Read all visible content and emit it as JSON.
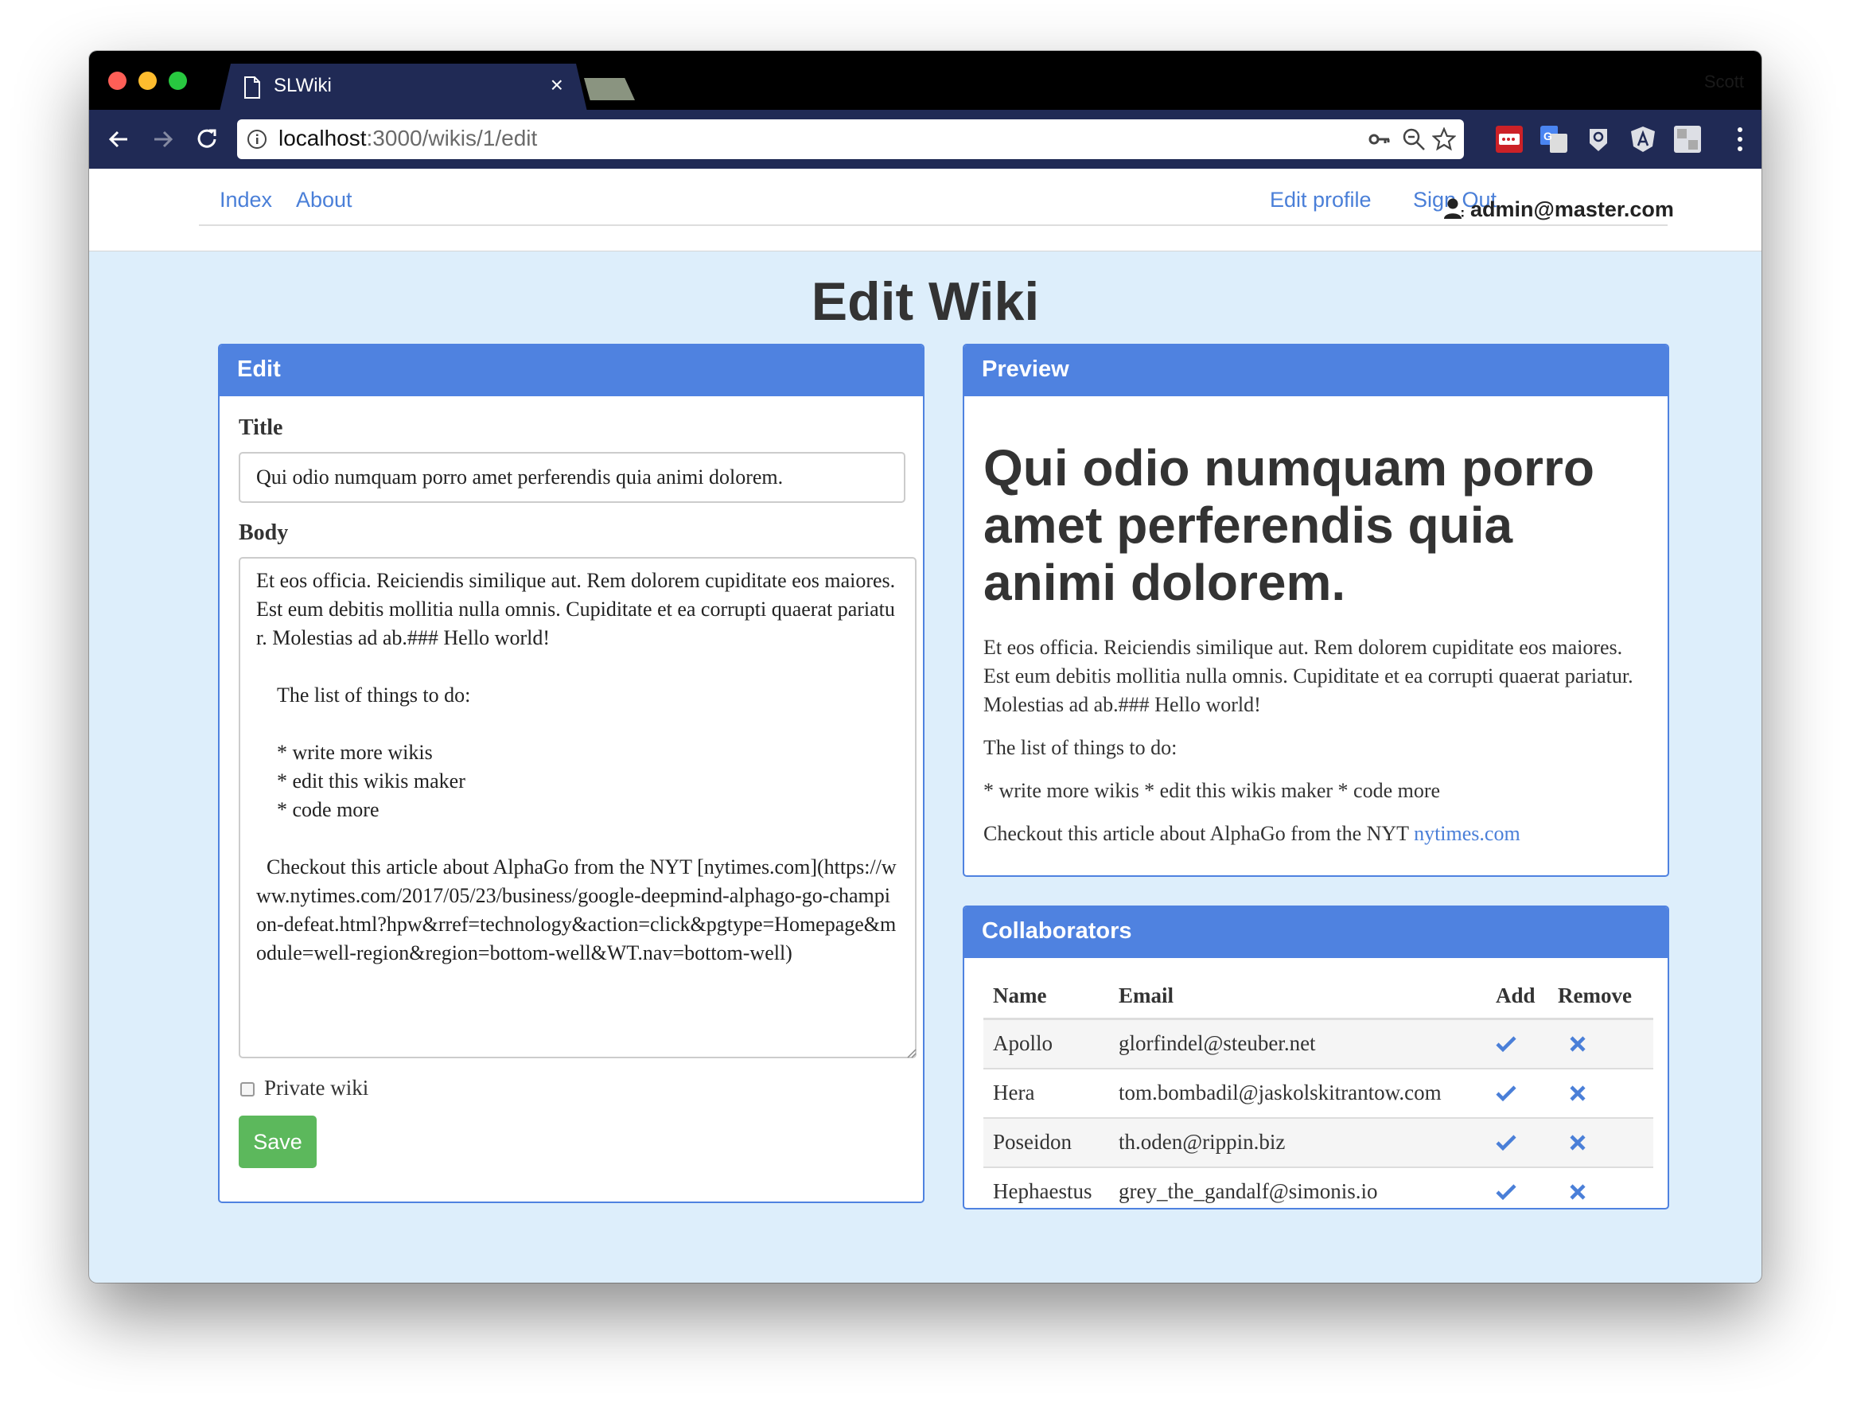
{
  "browser": {
    "tab_title": "SLWiki",
    "tab_close": "×",
    "profile_name": "Scott",
    "url_host": "localhost",
    "url_rest": ":3000/wikis/1/edit",
    "icons": [
      "back-icon",
      "forward-icon",
      "reload-icon",
      "info-icon",
      "key-icon",
      "zoom-icon",
      "star-icon",
      "lastpass-icon",
      "translate-icon",
      "bulb-icon",
      "angular-icon",
      "puzzle-icon",
      "menu-icon"
    ]
  },
  "nav": {
    "index": "Index",
    "about": "About",
    "edit_profile": "Edit profile",
    "sign_out": "Sign Out",
    "user_email": "admin@master.com"
  },
  "page": {
    "title": "Edit Wiki"
  },
  "edit": {
    "heading": "Edit",
    "title_label": "Title",
    "title_value": "Qui odio numquam porro amet perferendis quia animi dolorem.",
    "body_label": "Body",
    "body_value": "Et eos officia. Reiciendis similique aut. Rem dolorem cupiditate eos maiores. Est eum debitis mollitia nulla omnis. Cupiditate et ea corrupti quaerat pariatur. Molestias ad ab.### Hello world!\n\n    The list of things to do:\n\n    * write more wikis\n    * edit this wikis maker\n    * code more\n\n  Checkout this article about AlphaGo from the NYT [nytimes.com](https://www.nytimes.com/2017/05/23/business/google-deepmind-alphago-go-champion-defeat.html?hpw&rref=technology&action=click&pgtype=Homepage&module=well-region&region=bottom-well&WT.nav=bottom-well)",
    "private_label": "Private wiki",
    "save_label": "Save"
  },
  "preview": {
    "heading": "Preview",
    "h1": "Qui odio numquam porro amet perferendis quia animi dolorem.",
    "p1": "Et eos officia. Reiciendis similique aut. Rem dolorem cupiditate eos maiores. Est eum debitis mollitia nulla omnis. Cupiditate et ea corrupti quaerat pariatur. Molestias ad ab.### Hello world!",
    "p2": "The list of things to do:",
    "p3": "* write more wikis * edit this wikis maker * code more",
    "p4_text": "Checkout this article about AlphaGo from the NYT ",
    "p4_link": "nytimes.com"
  },
  "collaborators": {
    "heading": "Collaborators",
    "columns": [
      "Name",
      "Email",
      "Add",
      "Remove"
    ],
    "rows": [
      {
        "name": "Apollo",
        "email": "glorfindel@steuber.net"
      },
      {
        "name": "Hera",
        "email": "tom.bombadil@jaskolskitrantow.com"
      },
      {
        "name": "Poseidon",
        "email": "th.oden@rippin.biz"
      },
      {
        "name": "Hephaestus",
        "email": "grey_the_gandalf@simonis.io"
      }
    ],
    "add_icon": "checkmark-icon",
    "remove_icon": "x-icon"
  },
  "colors": {
    "accent": "#4f82e0",
    "link": "#4a7fd8",
    "save": "#5cb85c",
    "page_bg": "#ddeefb",
    "chrome": "#202a55"
  }
}
